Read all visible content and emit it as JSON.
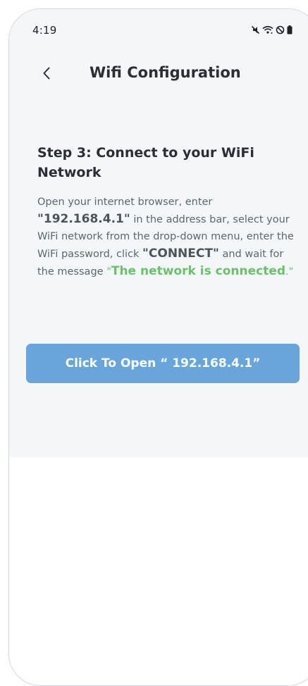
{
  "status_bar": {
    "time": "4:19",
    "icons": [
      "mute-icon",
      "wifi-icon",
      "do-not-disturb-icon",
      "battery-icon"
    ]
  },
  "header": {
    "back_icon": "chevron-left-icon",
    "title": "Wifi Configuration"
  },
  "step": {
    "title": "Step 3: Connect to your WiFi Network"
  },
  "instructions": {
    "part1": "Open your internet browser, enter ",
    "quote_open_1": "\"",
    "ip": "192.168.4.1",
    "quote_close_1": "\"",
    "part2": " in the address bar, select your WiFi network from the drop-down menu, enter the WiFi password, click ",
    "quote_open_2": "\"",
    "connect": "CONNECT",
    "quote_close_2": "\"",
    "part3": " and wait for the message ",
    "quote_open_3": "\"",
    "message": "The network is connected",
    "message_end": ".\""
  },
  "open_button": {
    "label": "Click To Open “ 192.168.4.1”"
  },
  "colors": {
    "accent": "#67a5da",
    "success": "#6bc06a",
    "background": "#f3f7fa"
  }
}
